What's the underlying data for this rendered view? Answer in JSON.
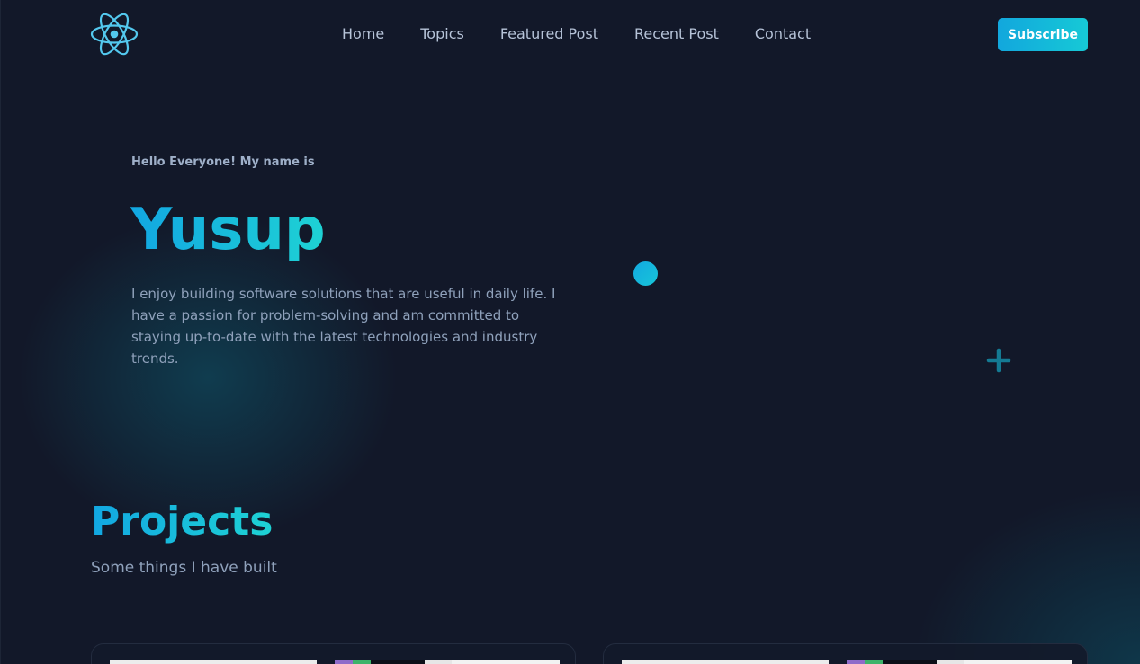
{
  "nav": {
    "links": [
      "Home",
      "Topics",
      "Featured Post",
      "Recent Post",
      "Contact"
    ],
    "subscribe_label": "Subscribe",
    "logo_icon": "react-atom-icon"
  },
  "hero": {
    "greeting": "Hello Everyone! My name is",
    "name": "Yusup",
    "description": "I enjoy building software solutions that are useful in daily life. I have a passion for problem-solving and am committed to staying up-to-date with the latest technologies and industry trends."
  },
  "projects": {
    "title": "Projects",
    "subtitle": "Some things I have built"
  },
  "colors": {
    "background": "#121829",
    "accent_start": "#12a7e2",
    "accent_end": "#1ed2d4",
    "nav_text": "#b6c3d8",
    "body_text": "#8fa1bb"
  }
}
